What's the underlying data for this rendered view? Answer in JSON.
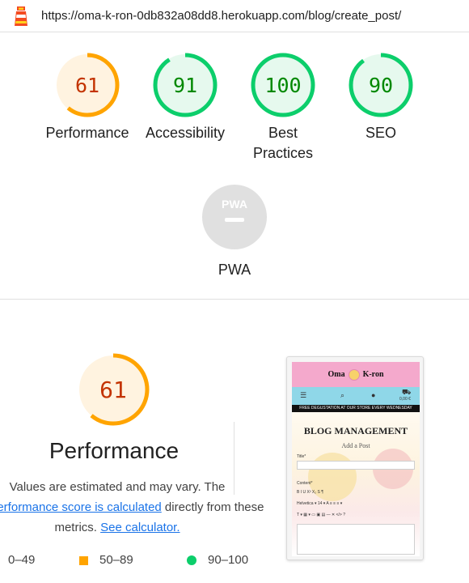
{
  "browser": {
    "url": "https://oma-k-ron-0db832a08dd8.herokuapp.com/blog/create_post/",
    "logo_icon": "lighthouse-icon"
  },
  "colors": {
    "average": "#ffa400",
    "average_bg": "#fff3e0",
    "average_text": "#c33300",
    "pass": "#0cce6b",
    "pass_bg": "#e6f9ee",
    "pass_text": "#008800",
    "fail": "#ff4e42",
    "na": "#e0e0e0",
    "link": "#1a73e8"
  },
  "scores": [
    {
      "value": 61,
      "display": "61",
      "label": "Performance",
      "rating": "average"
    },
    {
      "value": 91,
      "display": "91",
      "label": "Accessibility",
      "rating": "pass"
    },
    {
      "value": 100,
      "display": "100",
      "label": "Best Practices",
      "rating": "pass"
    },
    {
      "value": 90,
      "display": "90",
      "label": "SEO",
      "rating": "pass"
    }
  ],
  "pwa": {
    "badge": "PWA",
    "label": "PWA"
  },
  "performance": {
    "score": 61,
    "display": "61",
    "title": "Performance",
    "note_1": "Values are estimated and may vary. The",
    "note_2_link": "performance score is calculated",
    "note_2_rest": " directly from these",
    "note_3_pre": "metrics. ",
    "note_3_link": "See calculator.",
    "legend": [
      {
        "shape": "triangle",
        "range": "0–49"
      },
      {
        "shape": "square",
        "range": "50–89"
      },
      {
        "shape": "circle",
        "range": "90–100"
      }
    ]
  },
  "screenshot": {
    "brand_left": "Oma",
    "brand_right": "K-ron",
    "cart_total": "0,00 €",
    "banner": "FREE DEGUSTATION AT OUR STORE EVERY WEDNESDAY",
    "heading": "BLOG MANAGEMENT",
    "subheading": "Add a Post",
    "title_label": "Title*",
    "content_label": "Content*",
    "toolbar_row1": "B I U X² X₂ S ¶",
    "toolbar_row2": "Helvetica ▾  14 ▾  A  ≡  ≡  ≡ ▾",
    "toolbar_row3": "T ▾  ▦ ▾  ▭  ▣  ▤  —  ✕  </>  ?"
  }
}
